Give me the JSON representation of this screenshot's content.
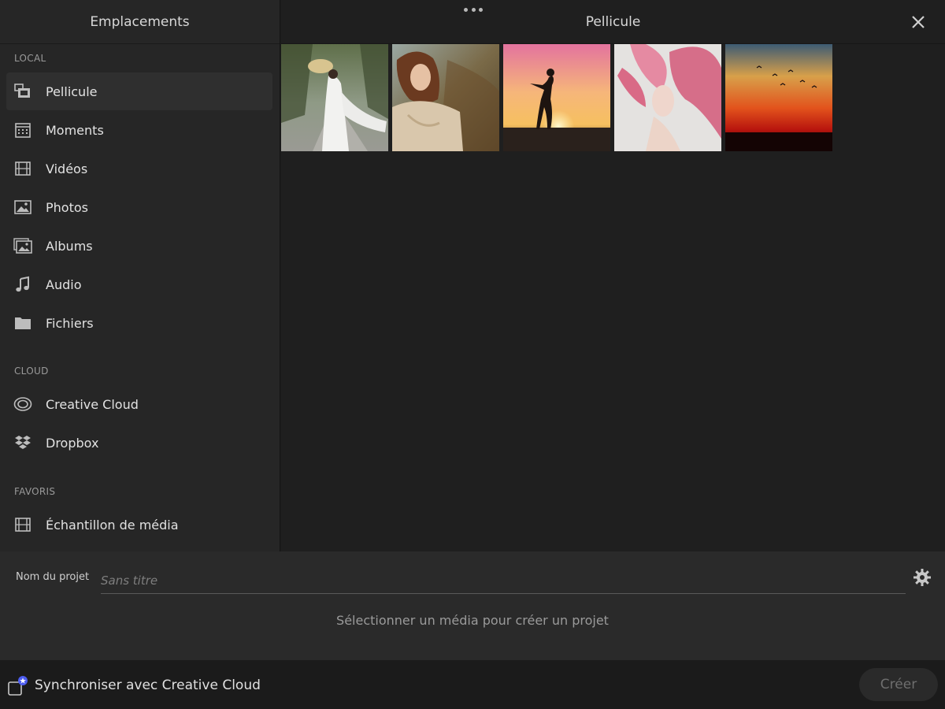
{
  "sidebar": {
    "title": "Emplacements",
    "sections": {
      "local": "LOCAL",
      "cloud": "CLOUD",
      "favorites": "FAVORIS"
    },
    "items": [
      {
        "label": "Pellicule",
        "icon": "camera-roll-icon",
        "active": true
      },
      {
        "label": "Moments",
        "icon": "calendar-icon"
      },
      {
        "label": "Vidéos",
        "icon": "film-icon"
      },
      {
        "label": "Photos",
        "icon": "image-icon"
      },
      {
        "label": "Albums",
        "icon": "albums-icon"
      },
      {
        "label": "Audio",
        "icon": "music-note-icon"
      },
      {
        "label": "Fichiers",
        "icon": "folder-icon"
      },
      {
        "label": "Creative Cloud",
        "icon": "creative-cloud-icon"
      },
      {
        "label": "Dropbox",
        "icon": "dropbox-icon"
      },
      {
        "label": "Échantillon de média",
        "icon": "film-icon"
      }
    ]
  },
  "main": {
    "title": "Pellicule",
    "more_icon": "more-dots-icon",
    "close_icon": "close-icon",
    "thumbnails": [
      {
        "subject": "woman in white dress with conical hat"
      },
      {
        "subject": "woman portrait in autumn"
      },
      {
        "subject": "silhouette dancing at sunset"
      },
      {
        "subject": "woman with pink flying hair"
      },
      {
        "subject": "red sunset sky with birds"
      }
    ]
  },
  "project": {
    "name_label": "Nom du projet",
    "name_placeholder": "Sans titre",
    "name_value": "",
    "hint": "Sélectionner un média pour créer un projet",
    "settings_icon": "gear-icon"
  },
  "footer": {
    "sync_label": "Synchroniser avec Creative Cloud",
    "sync_checked": false,
    "create_label": "Créer"
  },
  "colors": {
    "sidebar_bg": "#262626",
    "main_bg": "#1f1f1f",
    "panel_bg": "#2a2a2a",
    "footer_bg": "#1b1b1b",
    "badge_accent": "#4c5cf0"
  }
}
